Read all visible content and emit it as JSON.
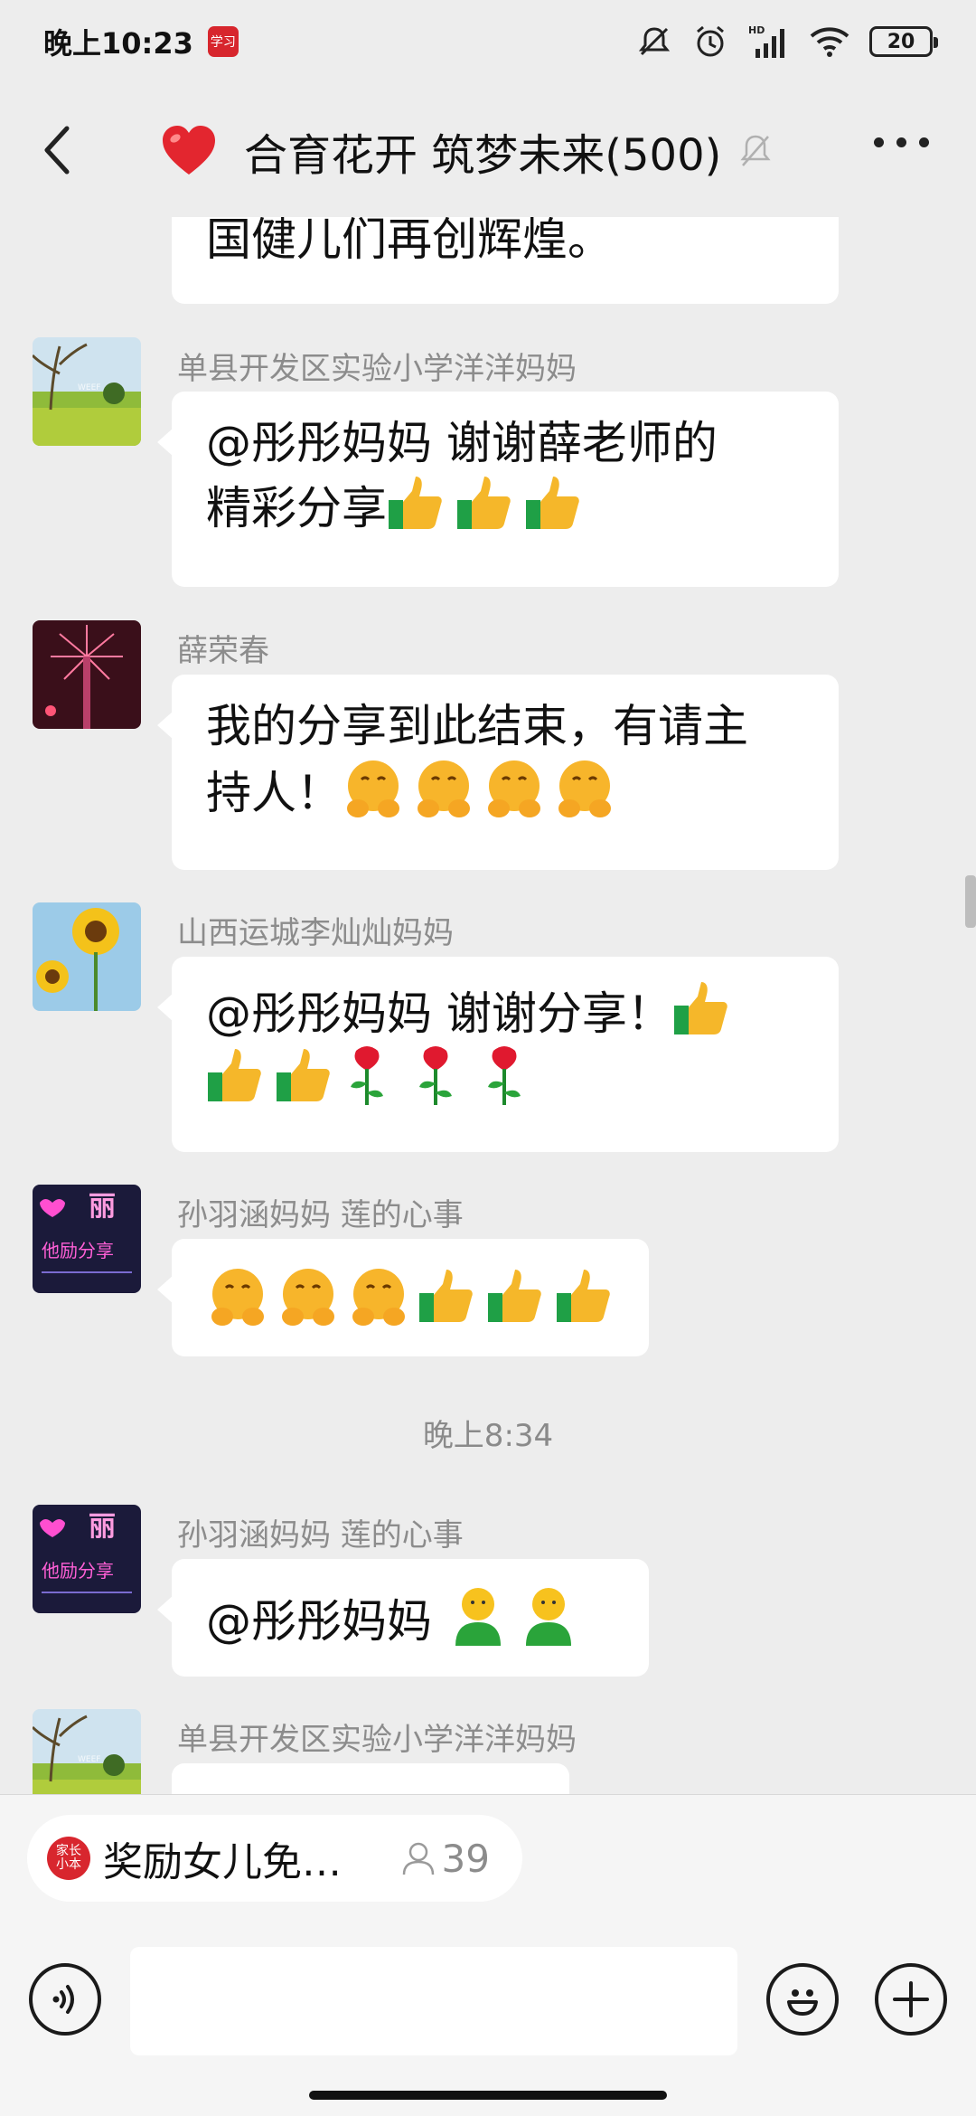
{
  "status_bar": {
    "time": "晚上10:23",
    "app_badge": "学习",
    "battery": "20"
  },
  "header": {
    "title": "合育花开 筑梦未来(500)",
    "icons": [
      "back-icon",
      "heart-icon",
      "mute-bell-icon",
      "more-icon"
    ]
  },
  "messages": [
    {
      "sender": "",
      "text": "国健儿们再创辉煌。"
    },
    {
      "sender": "单县开发区实验小学洋洋妈妈",
      "line1": "@彤彤妈妈  谢谢薛老师的",
      "line2": "精彩分享",
      "emojis": [
        "thumbs-up",
        "thumbs-up",
        "thumbs-up"
      ]
    },
    {
      "sender": "薛荣春",
      "line1": "我的分享到此结束，有请主",
      "line2": "持人！",
      "emojis": [
        "hushed-face",
        "hushed-face",
        "hushed-face",
        "hushed-face"
      ]
    },
    {
      "sender": "山西运城李灿灿妈妈",
      "line1": "@彤彤妈妈  谢谢分享！",
      "emojis_line1": [
        "thumbs-up"
      ],
      "emojis_line2": [
        "thumbs-up",
        "thumbs-up",
        "rose",
        "rose",
        "rose"
      ]
    },
    {
      "sender": "孙羽涵妈妈  莲的心事",
      "emojis": [
        "hushed-face",
        "hushed-face",
        "hushed-face",
        "thumbs-up",
        "thumbs-up",
        "thumbs-up"
      ]
    },
    {
      "sender": "孙羽涵妈妈  莲的心事",
      "text": "@彤彤妈妈 ",
      "emojis": [
        "person",
        "person"
      ]
    },
    {
      "sender": "单县开发区实验小学洋洋妈妈",
      "text": ""
    }
  ],
  "avatar_text": {
    "wf": "WEEF",
    "li": "丽",
    "neon": "他励分享"
  },
  "time_separator": "晚上8:34",
  "live_pill": {
    "logo": "家长\n小本",
    "text": "奖励女儿免…",
    "count": "39"
  },
  "input": {
    "placeholder": ""
  },
  "colors": {
    "background": "#ededed",
    "bubble": "#ffffff",
    "accent_red": "#d8262e"
  }
}
